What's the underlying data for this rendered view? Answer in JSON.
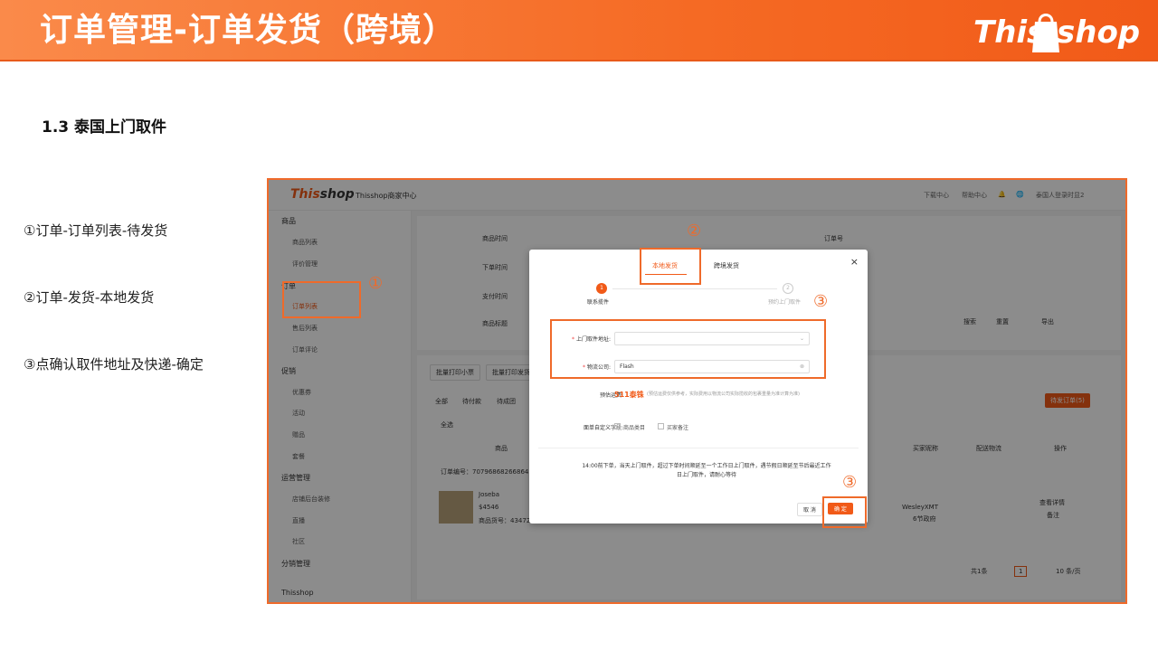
{
  "slide": {
    "title": "订单管理-订单发货（跨境）",
    "logo_this": "This",
    "logo_shop": "shop",
    "section": "1.3 泰国上门取件",
    "steps": [
      "①订单-订单列表-待发货",
      "②订单-发货-本地发货",
      "③点确认取件地址及快递-确定"
    ]
  },
  "app": {
    "logo_this": "This",
    "logo_shop": "shop",
    "center_title": "Thisshop商家中心",
    "top_right": [
      "下载中心",
      "帮助中心",
      "泰国人登录时显2"
    ],
    "sidebar": [
      {
        "heading": "商品",
        "items": [
          "商品列表",
          "评价管理"
        ]
      },
      {
        "heading": "订单",
        "items": [
          "订单列表",
          "售后列表",
          "订单评论"
        ]
      },
      {
        "heading": "促销",
        "items": [
          "优惠券",
          "活动",
          "赠品",
          "套餐"
        ]
      },
      {
        "heading": "运营管理",
        "items": [
          "店铺后台装修",
          "直播",
          "社区"
        ]
      },
      {
        "heading": "分销管理",
        "items": []
      }
    ],
    "sidebar_bottom": "Thisshop",
    "filters": [
      "商品时间",
      "下单时间",
      "支付时间",
      "商品标题",
      "订单号"
    ],
    "actions": [
      "搜索",
      "重置",
      "导出"
    ],
    "batch_buttons": [
      "批量打印小票",
      "批量打印发货单"
    ],
    "order_tabs": [
      "全部",
      "待付款",
      "待成团"
    ],
    "batch_ship": "待发订单(5)",
    "select_all": "全选",
    "table_headers": [
      "商品",
      "买家昵称",
      "配送物流",
      "操作"
    ],
    "order_no_label": "订单编号：7079686826686457",
    "product_name": "Joseba",
    "product_price": "$4546",
    "product_sku": "商品货号：4347227",
    "buyer": "WesleyXMT",
    "buyer_note": "6节政府",
    "row_action1": "查看详情",
    "row_action2": "备注",
    "pagination": "共1条",
    "page_num": "1",
    "page_size": "10 条/页"
  },
  "modal": {
    "tab_local": "本地发货",
    "tab_cross": "跨境发货",
    "step1_num": "1",
    "step1_label": "联系揽件",
    "step2_num": "2",
    "step2_label": "预约上门取件",
    "pickup_label": "上门取件地址:",
    "pickup_value": "",
    "carrier_label": "物流公司:",
    "carrier_value": "Flash",
    "fee_label": "预估运费:",
    "fee_value": "511泰铢",
    "fee_note": "(预估运费仅供参考，实际费用以物流公司实际揽收的包裹重量为准计算为准)",
    "custom_label": "面单自定义字段:",
    "opt1": "商品类目",
    "opt2": "买家备注",
    "note": "14:00前下单，当天上门取件，超过下单时间顺延至一个工作日上门取件，遇节假日顺延至节后最近工作日上门取件，请耐心等待",
    "cancel": "取 消",
    "ok": "确 定"
  },
  "annotations": [
    "①",
    "②",
    "③",
    "③"
  ]
}
